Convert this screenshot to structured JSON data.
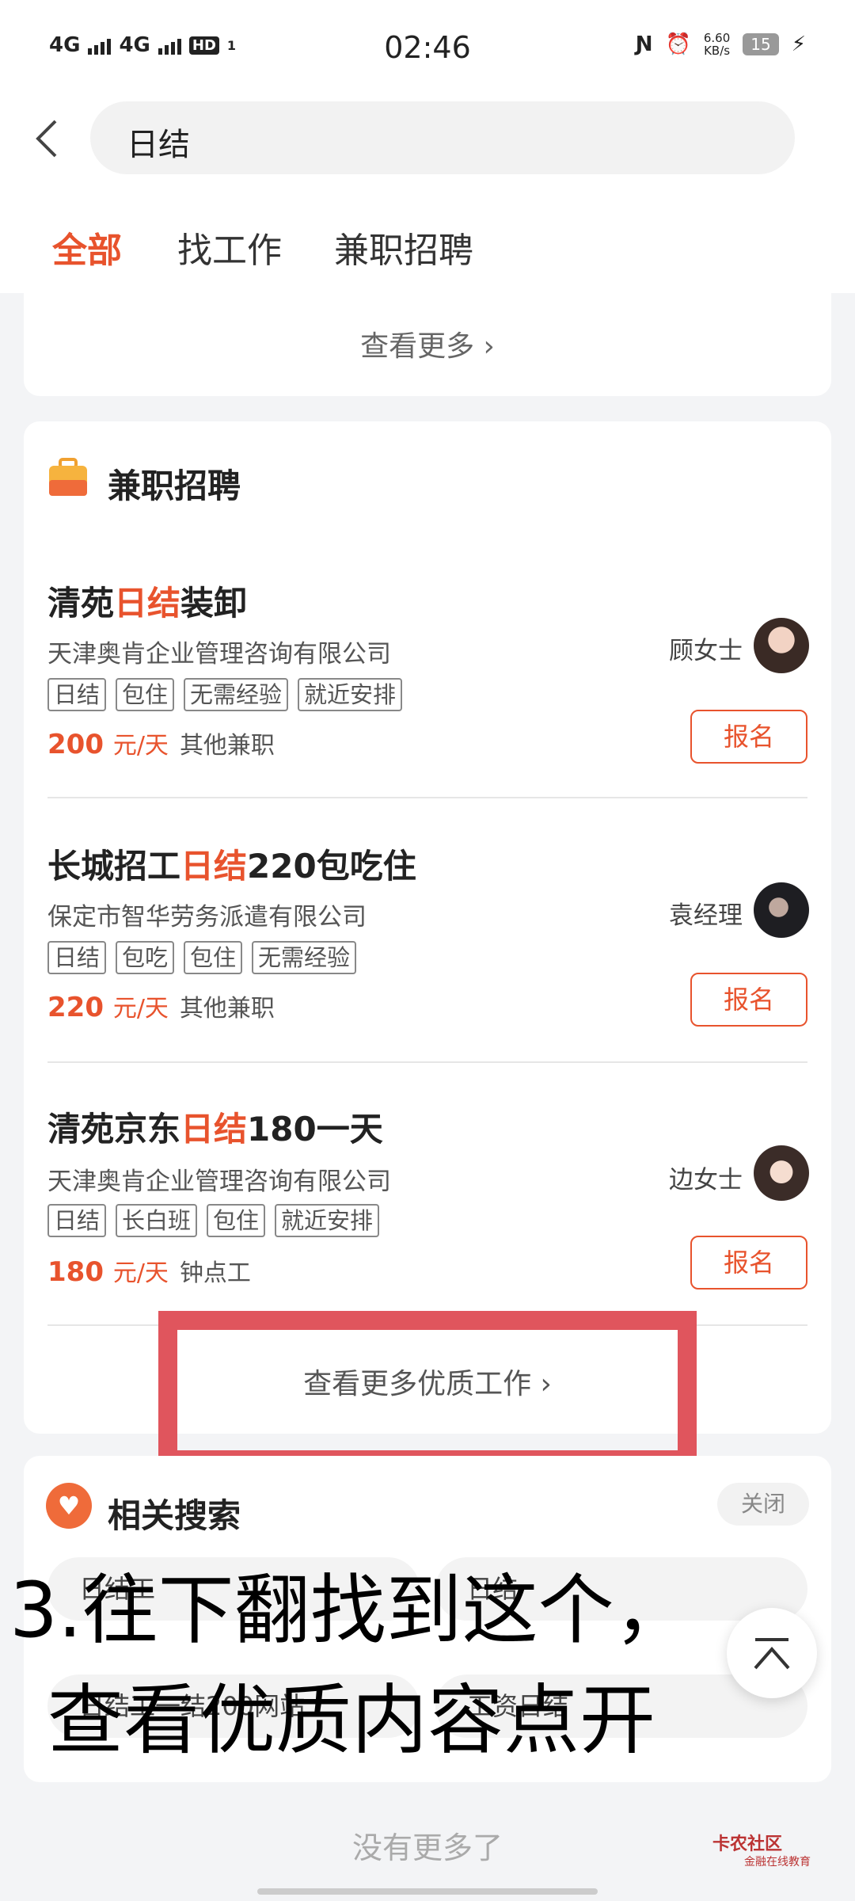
{
  "status_bar": {
    "network1": "4G",
    "network2": "4G",
    "hd": "HD",
    "sim": "1",
    "time": "02:46",
    "speed_value": "6.60",
    "speed_unit": "KB/s",
    "battery": "15"
  },
  "search": {
    "query": "日结"
  },
  "tabs": [
    {
      "label": "全部",
      "active": true
    },
    {
      "label": "找工作",
      "active": false
    },
    {
      "label": "兼职招聘",
      "active": false
    }
  ],
  "top_card": {
    "see_more": "查看更多 "
  },
  "parttime": {
    "title": "兼职招聘",
    "jobs": [
      {
        "title_pre": "清苑",
        "title_hl": "日结",
        "title_post": "装卸",
        "company": "天津奥肯企业管理咨询有限公司",
        "tags": [
          "日结",
          "包住",
          "无需经验",
          "就近安排"
        ],
        "salary": "200",
        "unit": "元/天",
        "type": "其他兼职",
        "contact": "顾女士",
        "button": "报名"
      },
      {
        "title_pre": "长城招工",
        "title_hl": "日结",
        "title_post": "220包吃住",
        "company": "保定市智华劳务派遣有限公司",
        "tags": [
          "日结",
          "包吃",
          "包住",
          "无需经验"
        ],
        "salary": "220",
        "unit": "元/天",
        "type": "其他兼职",
        "contact": "袁经理",
        "button": "报名"
      },
      {
        "title_pre": "清苑京东",
        "title_hl": "日结",
        "title_post": "180一天",
        "company": "天津奥肯企业管理咨询有限公司",
        "tags": [
          "日结",
          "长白班",
          "包住",
          "就近安排"
        ],
        "salary": "180",
        "unit": "元/天",
        "type": "钟点工",
        "contact": "边女士",
        "button": "报名"
      }
    ],
    "see_more": "查看更多优质工作 "
  },
  "related": {
    "title": "相关搜索",
    "close": "关闭",
    "chips": [
      "日结工",
      "日结",
      "日结工一结200网站",
      "工资日结"
    ]
  },
  "overlay": {
    "line1": "3.往下翻找到这个，",
    "line2": "查看优质内容点开"
  },
  "footer": {
    "no_more": "没有更多了",
    "watermark": "卡农社区",
    "watermark_sub": "金融在线教育"
  },
  "colors": {
    "accent": "#e8532d",
    "annotation": "#e0555d"
  }
}
